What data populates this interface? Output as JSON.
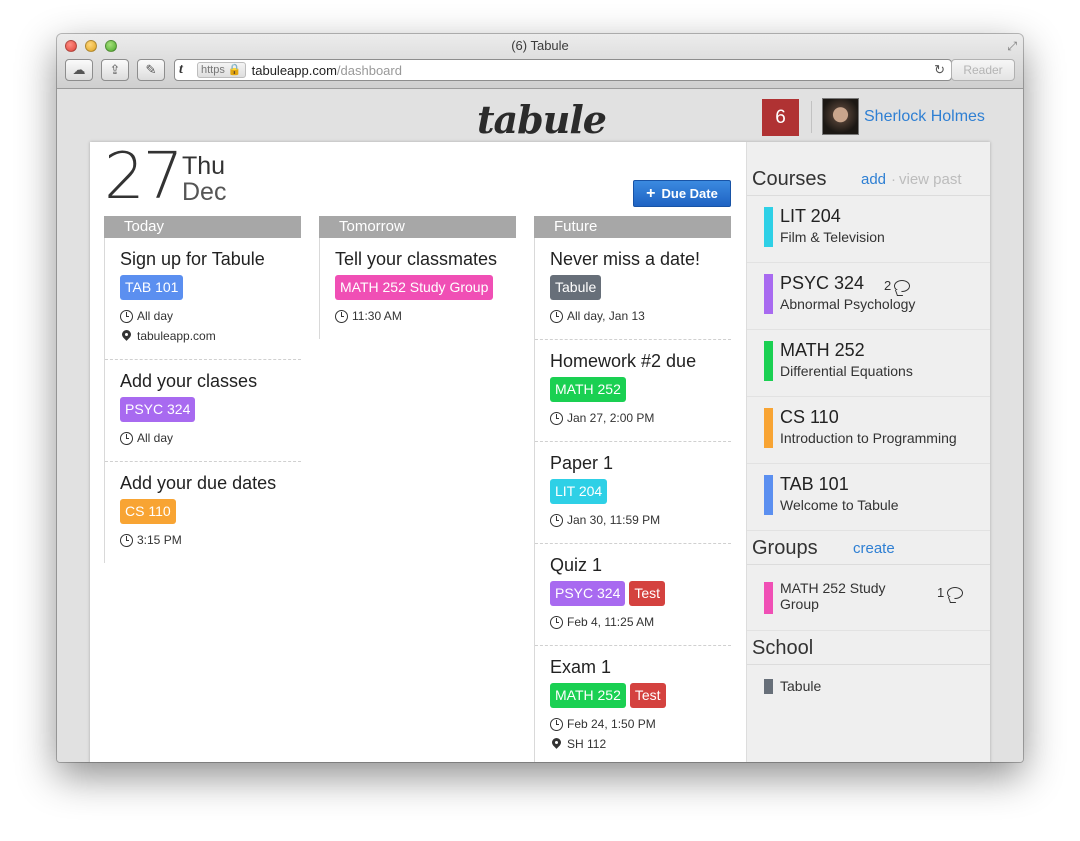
{
  "window": {
    "title": "(6) Tabule"
  },
  "toolbar": {
    "favicon": "t",
    "https_label": "https",
    "domain": "tabuleapp.com",
    "path": "/dashboard",
    "reader_label": "Reader"
  },
  "header": {
    "logo": "tabule",
    "notification_count": "6",
    "user_name": "Sherlock Holmes"
  },
  "date": {
    "day": "27",
    "weekday": "Thu",
    "month": "Dec"
  },
  "due_button": {
    "label": "Due Date"
  },
  "colors": {
    "blue": "#5b8ff0",
    "purple": "#a86af0",
    "orange": "#f8a433",
    "pink": "#f04fb5",
    "green": "#1ad052",
    "cyan": "#2ed0e6",
    "gray": "#676f79",
    "red": "#d4423f"
  },
  "columns": [
    {
      "title": "Today",
      "items": [
        {
          "title": "Sign up for Tabule",
          "tags": [
            {
              "label": "TAB 101",
              "color": "#5b8ff0"
            }
          ],
          "time": "All day",
          "location": "tabuleapp.com"
        },
        {
          "title": "Add your classes",
          "tags": [
            {
              "label": "PSYC 324",
              "color": "#a86af0"
            }
          ],
          "time": "All day"
        },
        {
          "title": "Add your due dates",
          "tags": [
            {
              "label": "CS 110",
              "color": "#f8a433"
            }
          ],
          "time": "3:15 PM"
        }
      ]
    },
    {
      "title": "Tomorrow",
      "items": [
        {
          "title": "Tell your classmates",
          "tags": [
            {
              "label": "MATH 252 Study Group",
              "color": "#f04fb5"
            }
          ],
          "time": "11:30 AM"
        }
      ]
    },
    {
      "title": "Future",
      "items": [
        {
          "title": "Never miss a date!",
          "tags": [
            {
              "label": "Tabule",
              "color": "#676f79"
            }
          ],
          "time": "All day, Jan 13"
        },
        {
          "title": "Homework #2 due",
          "tags": [
            {
              "label": "MATH 252",
              "color": "#1ad052"
            }
          ],
          "time": "Jan 27, 2:00 PM"
        },
        {
          "title": "Paper 1",
          "tags": [
            {
              "label": "LIT 204",
              "color": "#2ed0e6"
            }
          ],
          "time": "Jan 30, 11:59 PM"
        },
        {
          "title": "Quiz 1",
          "tags": [
            {
              "label": "PSYC 324",
              "color": "#a86af0"
            },
            {
              "label": "Test",
              "color": "#d4423f"
            }
          ],
          "time": "Feb 4, 11:25 AM"
        },
        {
          "title": "Exam 1",
          "tags": [
            {
              "label": "MATH 252",
              "color": "#1ad052"
            },
            {
              "label": "Test",
              "color": "#d4423f"
            }
          ],
          "time": "Feb 24, 1:50 PM",
          "location": "SH 112"
        }
      ]
    }
  ],
  "sidebar": {
    "courses": {
      "title": "Courses",
      "add_label": "add",
      "separator": "·",
      "view_past_label": "view past",
      "items": [
        {
          "code": "LIT 204",
          "name": "Film & Television",
          "color": "#2ed0e6"
        },
        {
          "code": "PSYC 324",
          "name": "Abnormal Psychology",
          "color": "#a86af0",
          "comments": "2"
        },
        {
          "code": "MATH 252",
          "name": "Differential Equations",
          "color": "#1ad052"
        },
        {
          "code": "CS 110",
          "name": "Introduction to Programming",
          "color": "#f8a433"
        },
        {
          "code": "TAB 101",
          "name": "Welcome to Tabule",
          "color": "#5b8ff0"
        }
      ]
    },
    "groups": {
      "title": "Groups",
      "create_label": "create",
      "items": [
        {
          "name": "MATH 252 Study Group",
          "color": "#f04fb5",
          "comments": "1"
        }
      ]
    },
    "school": {
      "title": "School",
      "items": [
        {
          "name": "Tabule",
          "color": "#676f79"
        }
      ]
    }
  }
}
